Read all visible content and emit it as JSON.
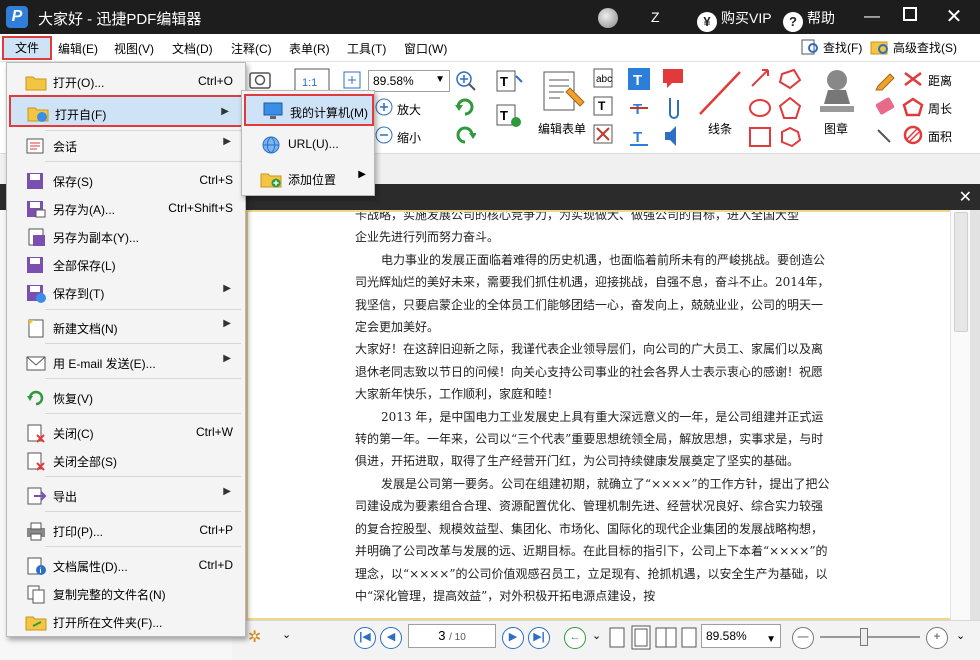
{
  "window": {
    "title": "大家好 - 迅捷PDF编辑器",
    "user": "Z",
    "buy_vip": "购买VIP",
    "help": "帮助",
    "logo_letter": "P"
  },
  "menubar": {
    "items": [
      "文件",
      "编辑(E)",
      "视图(V)",
      "文档(D)",
      "注释(C)",
      "表单(R)",
      "工具(T)",
      "窗口(W)"
    ],
    "find": "查找(F)",
    "advanced_find": "高级查找(S)"
  },
  "toolbar": {
    "zoom_value": "89.58%",
    "enlarge": "放大",
    "shrink": "缩小",
    "edit_form": "编辑表单",
    "line": "线条",
    "stamp": "图章",
    "distance": "距离",
    "perimeter": "周长",
    "area": "面积"
  },
  "file_menu": {
    "items": [
      {
        "label": "打开(O)...",
        "key": "Ctrl+O",
        "icon": "open-folder-icon"
      },
      {
        "label": "打开自(F)",
        "submenu": true,
        "icon": "open-from-icon"
      },
      {
        "label": "会话",
        "submenu": true,
        "icon": "session-icon"
      },
      {
        "label": "保存(S)",
        "key": "Ctrl+S",
        "icon": "save-icon"
      },
      {
        "label": "另存为(A)...",
        "key": "Ctrl+Shift+S",
        "icon": "save-as-icon"
      },
      {
        "label": "另存为副本(Y)...",
        "icon": "save-copy-icon"
      },
      {
        "label": "全部保存(L)",
        "icon": "save-all-icon"
      },
      {
        "label": "保存到(T)",
        "submenu": true,
        "icon": "save-to-icon"
      },
      {
        "label": "新建文档(N)",
        "submenu": true,
        "icon": "new-document-icon"
      },
      {
        "label": "用 E-mail 发送(E)...",
        "submenu": true,
        "icon": "email-icon"
      },
      {
        "label": "恢复(V)",
        "icon": "restore-icon"
      },
      {
        "label": "关闭(C)",
        "key": "Ctrl+W",
        "icon": "close-document-icon"
      },
      {
        "label": "关闭全部(S)",
        "icon": "close-all-icon"
      },
      {
        "label": "导出",
        "submenu": true,
        "icon": "export-icon"
      },
      {
        "label": "打印(P)...",
        "key": "Ctrl+P",
        "icon": "print-icon"
      },
      {
        "label": "文档属性(D)...",
        "key": "Ctrl+D",
        "icon": "document-properties-icon"
      },
      {
        "label": "复制完整的文件名(N)",
        "icon": "copy-filename-icon"
      },
      {
        "label": "打开所在文件夹(F)...",
        "icon": "open-containing-folder-icon"
      }
    ]
  },
  "submenu": {
    "items": [
      {
        "label": "我的计算机(M)",
        "icon": "computer-icon"
      },
      {
        "label": "URL(U)...",
        "icon": "globe-icon"
      },
      {
        "label": "添加位置",
        "submenu": true,
        "icon": "add-location-icon"
      }
    ]
  },
  "document": {
    "paragraphs": [
      {
        "text": "    卡战略，实施发展公司的核心竞争力，为实现做大、做强公司的目标，进入全国大型",
        "indent": false
      },
      {
        "text": "企业先进行列而努力奋斗。",
        "indent": false
      },
      {
        "text": "电力事业的发展正面临着难得的历史机遇，也面临着前所未有的严峻挑战。要创造公司光辉灿烂的美好未来，需要我们抓住机遇，迎接挑战，自强不息，奋斗不止。2014年，我坚信，只要启蒙企业的全体员工们能够团结一心，奋发向上，兢兢业业，公司的明天一定会更加美好。",
        "indent": true
      },
      {
        "text": "大家好！在这辞旧迎新之际，我谨代表企业领导层们，向公司的广大员工、家属们以及离退休老同志致以节日的问候！向关心支持公司事业的社会各界人士表示衷心的感谢！祝愿大家新年快乐，工作顺利，家庭和睦！",
        "indent": false
      },
      {
        "text": "2013 年，是中国电力工业发展史上具有重大深远意义的一年，是公司组建并正式运转的第一年。一年来，公司以“三个代表”重要思想统领全局，解放思想，实事求是，与时俱进，开拓进取，取得了生产经营开门红，为公司持续健康发展奠定了坚实的基础。",
        "indent": true
      },
      {
        "text": "发展是公司第一要务。公司在组建初期，就确立了“××××”的工作方针，提出了把公司建设成为要素组合合理、资源配置优化、管理机制先进、经营状况良好、综合实力较强的复合控股型、规模效益型、集团化、市场化、国际化的现代企业集团的发展战略构想，并明确了公司改革与发展的远、近期目标。在此目标的指引下，公司上下本着“××××”的理念，以“××××”的公司价值观感召员工，立足现有、抢抓机遇，以安全生产为基础，以中“深化管理，提高效益”，对外积极开拓电源点建设，按",
        "indent": true
      }
    ]
  },
  "bottom_bar": {
    "current_page": "3",
    "total_pages": "/ 10",
    "zoom_value": "89.58%"
  }
}
